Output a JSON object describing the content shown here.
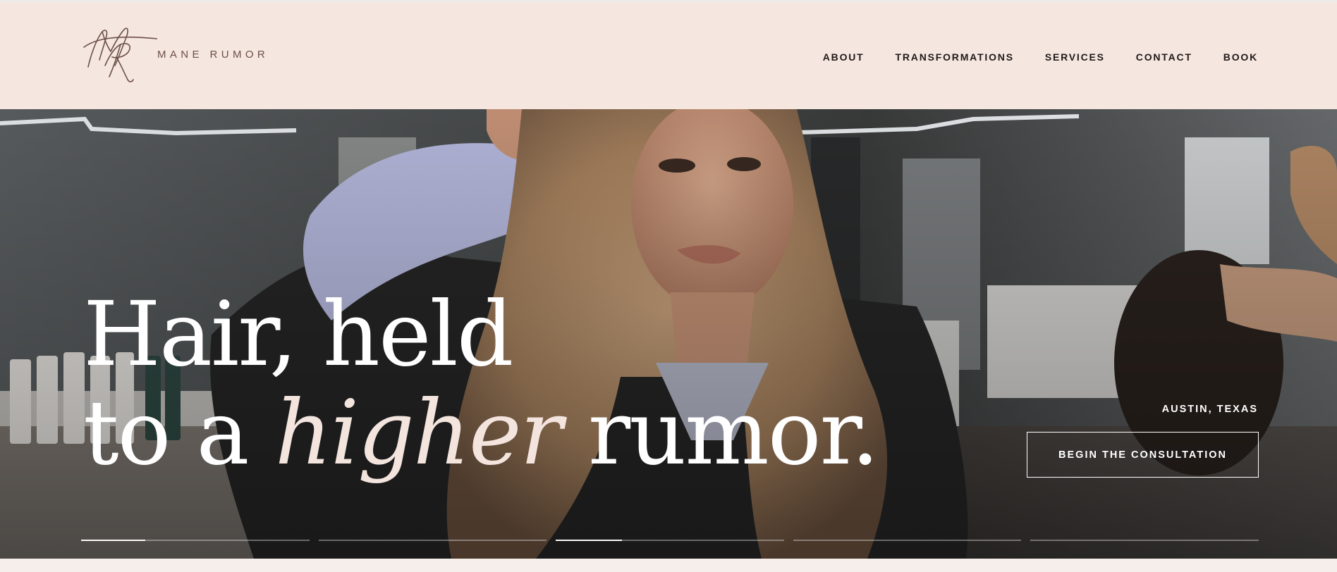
{
  "brand": {
    "name": "MANE RUMOR",
    "logo_icon": "mr-monogram-icon"
  },
  "nav": {
    "items": [
      {
        "label": "ABOUT"
      },
      {
        "label": "TRANSFORMATIONS"
      },
      {
        "label": "SERVICES"
      },
      {
        "label": "CONTACT"
      },
      {
        "label": "BOOK"
      }
    ]
  },
  "hero": {
    "headline": {
      "line1": "Hair, held",
      "line2_pre": "to a",
      "line2_italic": "higher",
      "line2_post": "rumor."
    },
    "location": "AUSTIN, TEXAS",
    "cta_label": "BEGIN THE CONSULTATION",
    "slides": [
      {
        "progress": 0.28
      },
      {
        "progress": 0.0
      },
      {
        "progress": 0.29
      },
      {
        "progress": 0.0
      },
      {
        "progress": 0.0
      }
    ]
  },
  "colors": {
    "header_bg": "#f6e6e0",
    "accent_blush": "#f3e4de",
    "nav_text": "#1f1a18",
    "logo_text": "#6b5048"
  }
}
